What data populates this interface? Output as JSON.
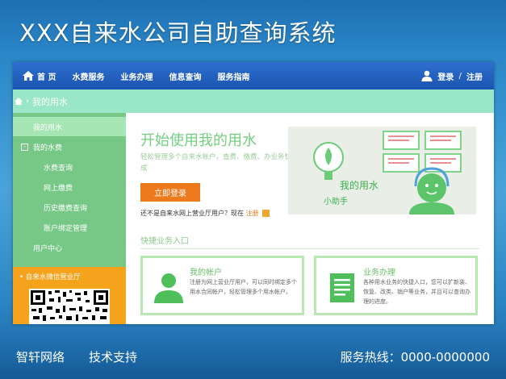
{
  "page_title": "XXX自来水公司自助查询系统",
  "topnav": {
    "home": "首 页",
    "items": [
      "水费服务",
      "业务办理",
      "信息查询",
      "服务指南"
    ],
    "login": "登录",
    "separator": "/",
    "register": "注册"
  },
  "breadcrumb": {
    "arrow": "›",
    "current": "我的用水"
  },
  "sidebar": {
    "items": [
      {
        "label": "我的用水",
        "bullet": ""
      },
      {
        "label": "我的水费",
        "bullet": "-"
      },
      {
        "label": "水费查询",
        "bullet": ""
      },
      {
        "label": "网上缴费",
        "bullet": ""
      },
      {
        "label": "历史缴费查询",
        "bullet": ""
      },
      {
        "label": "账户绑定管理",
        "bullet": ""
      },
      {
        "label": "用户中心",
        "bullet": ""
      }
    ],
    "promo": "• 自来水微信营业厅"
  },
  "hero": {
    "title": "开始使用我的用水",
    "subtitle": "轻松管理多个自来水帐户，查费、缴费、办业务快捷完成",
    "login_button": "立即登录",
    "register_note": "还不是自来水网上营业厅用户？现在",
    "register_link": "注册",
    "image_title": "我的用水",
    "image_sub": "小助手"
  },
  "quick": {
    "title": "快捷业务入口",
    "cards": [
      {
        "title": "我的帐户",
        "desc": "注册为网上营业厅用户，可以同时绑定多个用水合同帐户，轻松管理多个用水帐户。",
        "icon": "user-icon"
      },
      {
        "title": "业务办理",
        "desc": "各种用水业务的快捷入口，您可以扩新装、恢复、改类、销户等业务，并且可以查询办理的进度。",
        "icon": "document-icon"
      }
    ]
  },
  "footer": {
    "left": "智轩网络　　技术支持",
    "right": "服务热线：0000-0000000"
  },
  "colors": {
    "nav_blue": "#1b54b0",
    "mint": "#9ae6c8",
    "sidebar_green": "#77c887",
    "orange": "#ee7a1e",
    "accent_green": "#72cf7f"
  }
}
